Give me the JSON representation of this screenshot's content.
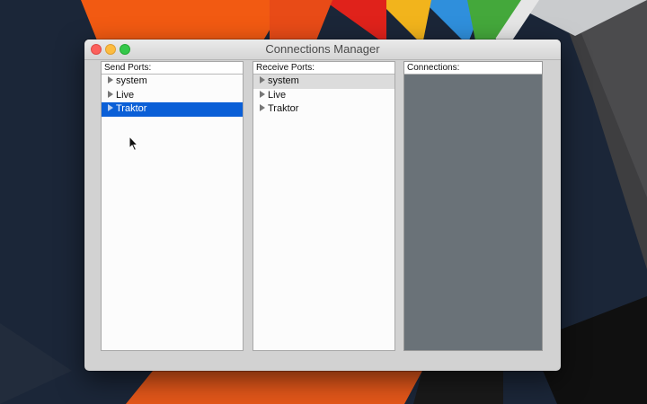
{
  "window": {
    "title": "Connections Manager"
  },
  "send_ports": {
    "header": "Send Ports:",
    "items": [
      {
        "label": "system",
        "selected": false
      },
      {
        "label": "Live",
        "selected": false
      },
      {
        "label": "Traktor",
        "selected": true
      }
    ]
  },
  "receive_ports": {
    "header": "Receive Ports:",
    "items": [
      {
        "label": "system",
        "highlighted": true
      },
      {
        "label": "Live",
        "highlighted": false
      },
      {
        "label": "Traktor",
        "highlighted": false
      }
    ]
  },
  "connections": {
    "header": "Connections:"
  },
  "colors": {
    "selection": "#0a5fd7",
    "connections_background": "#6a7278",
    "close": "#fc605c",
    "minimize": "#fdbc40",
    "maximize": "#34c84a"
  }
}
